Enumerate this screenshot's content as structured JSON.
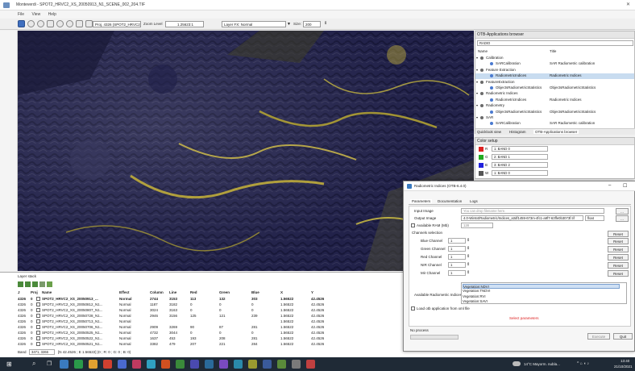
{
  "window": {
    "title": "Monteverdi - SPOT2_HRVC2_XS_20050913_N1_SCENE_002_204.TIF"
  },
  "menu": [
    "File",
    "View",
    "Help"
  ],
  "toolbar": {
    "projection": "Proj. 4326 (SPOT2_HRVC2_XS_2005...)",
    "zoom_label": "Zoom Level",
    "zoom_value": "1.25623:1",
    "layer_fx": "Layer FX: Normal",
    "size_label": "Size:",
    "size_value": "200"
  },
  "otb_browser": {
    "header": "OTB-Applications browser",
    "search_value": "RADIO",
    "col_name": "Name",
    "col_title": "Title",
    "rows": [
      {
        "type": "group",
        "name": "Calibration",
        "title": ""
      },
      {
        "type": "app",
        "name": "SARCalibration",
        "title": "SAR Radiometric calibration"
      },
      {
        "type": "group",
        "name": "Feature Extraction",
        "title": ""
      },
      {
        "type": "app",
        "name": "RadiometricIndices",
        "title": "Radiometric Indices"
      },
      {
        "type": "group",
        "name": "FeatureExtraction",
        "title": ""
      },
      {
        "type": "app",
        "name": "ObjectsRadiometricStatistics",
        "title": "ObjectsRadiometricStatistics"
      },
      {
        "type": "group",
        "name": "Radiometric Indices",
        "title": ""
      },
      {
        "type": "app",
        "name": "RadiometricIndices",
        "title": "Radiometric Indices"
      },
      {
        "type": "group",
        "name": "Radiometry",
        "title": ""
      },
      {
        "type": "app",
        "name": "ObjectsRadiometricStatistics",
        "title": "ObjectsRadiometricStatistics"
      },
      {
        "type": "group",
        "name": "SAR",
        "title": ""
      },
      {
        "type": "app",
        "name": "SARCalibration",
        "title": "SAR Radiometric calibration"
      }
    ],
    "tabs": [
      "Quicklook view",
      "Histogram",
      "OTB-Applications browser"
    ]
  },
  "color_setup": {
    "header": "Color setup",
    "bands": [
      {
        "channel": "R",
        "color": "#d22",
        "value": "1: BAND 0"
      },
      {
        "channel": "G",
        "color": "#2a2",
        "value": "2: BAND 1"
      },
      {
        "channel": "B",
        "color": "#22d",
        "value": "3: BAND 2"
      },
      {
        "channel": "W",
        "color": "#555",
        "value": "1: BAND 0"
      }
    ]
  },
  "layer_stack": {
    "header": "Layer stack",
    "columns": [
      "J",
      "Proj",
      "Name",
      "Effect",
      "Column",
      "Line",
      "Red",
      "Green",
      "Blue",
      "X",
      "Y"
    ],
    "rows": [
      [
        "4326",
        "0",
        "SPOT2_HRVC2_XS_20050913_...",
        "Normal",
        "2744",
        "3153",
        "113",
        "132",
        "303",
        "1.56522",
        "42.4526"
      ],
      [
        "4326",
        "0",
        "SPOT2_HRVC2_XS_20050812_N1...",
        "Normal",
        "1187",
        "3182",
        "0",
        "0",
        "0",
        "1.56522",
        "42.4526"
      ],
      [
        "4326",
        "0",
        "SPOT2_HRVC2_XS_20050807_N1...",
        "Normal",
        "3024",
        "3163",
        "0",
        "0",
        "0",
        "1.56522",
        "42.4526"
      ],
      [
        "4326",
        "0",
        "SPOT2_HRVC2_XS_20050728_N1...",
        "Normal",
        "2946",
        "3156",
        "125",
        "121",
        "239",
        "1.56522",
        "42.4526"
      ],
      [
        "4326",
        "0",
        "SPOT2_HRVC2_XS_20050713_N1...",
        "Normal",
        "",
        "",
        "",
        "",
        "",
        "1.56522",
        "42.4526"
      ],
      [
        "4326",
        "0",
        "SPOT2_HRVC2_XS_20050706_N1...",
        "Normal",
        "2909",
        "3269",
        "90",
        "87",
        "281",
        "1.56522",
        "42.4526"
      ],
      [
        "4326",
        "0",
        "SPOT2_HRVC2_XS_20050525_N1...",
        "Normal",
        "4732",
        "3044",
        "0",
        "0",
        "0",
        "1.56522",
        "42.4526"
      ],
      [
        "4326",
        "0",
        "SPOT2_HRVC2_XS_20050522_N1...",
        "Normal",
        "1637",
        "453",
        "193",
        "208",
        "281",
        "1.56522",
        "42.4526"
      ],
      [
        "4326",
        "0",
        "SPOT2_HRVC2_XS_20050521_N1...",
        "Normal",
        "3382",
        "479",
        "207",
        "221",
        "284",
        "1.56522",
        "42.4526"
      ]
    ],
    "status_left": "Band",
    "status_coords": "3471, 3266",
    "status_geo": "[N 42.4526 ; E 1.56522] (0 ; R: 0 ; G: 0 ; B: 0)"
  },
  "dialog": {
    "title": "Radiometric Indices (OTB-6.4.0)",
    "tabs": [
      "Parameters",
      "Documentation",
      "Logs"
    ],
    "input_image_label": "Input Image",
    "input_image_placeholder": "You can drop filename here.",
    "output_image_label": "Output Image",
    "output_image_value": "4.0-Win64/Radiometric/Indices_a3df1459-673m-4fc1-a9f7-63ffe0b3073f.tif",
    "output_type": "float",
    "ram_label": "Available RAM (Mb)",
    "ram_value": "128",
    "channels_label": "Channels selection",
    "channels": [
      {
        "label": "Blue Channel",
        "value": "1"
      },
      {
        "label": "Green Channel",
        "value": "1"
      },
      {
        "label": "Red Channel",
        "value": "1"
      },
      {
        "label": "NIR Channel",
        "value": "1"
      },
      {
        "label": "Mir Channel",
        "value": "1"
      }
    ],
    "reset_label": "Reset",
    "indices_label": "Available Radiometric Indices",
    "indices_options": [
      "Vegetation:NDVI",
      "Vegetation:TNDVI",
      "Vegetation:RVI",
      "Vegetation:SAVI"
    ],
    "load_xml_label": "Load otb application from xml file",
    "warning": "Select parameters",
    "progress_label": "No process",
    "execute_label": "Execute",
    "quit_label": "Quit"
  },
  "taskbar": {
    "weather": "14°C  Mayorm. nubla...",
    "time": "13:40",
    "date": "21/10/2021"
  }
}
